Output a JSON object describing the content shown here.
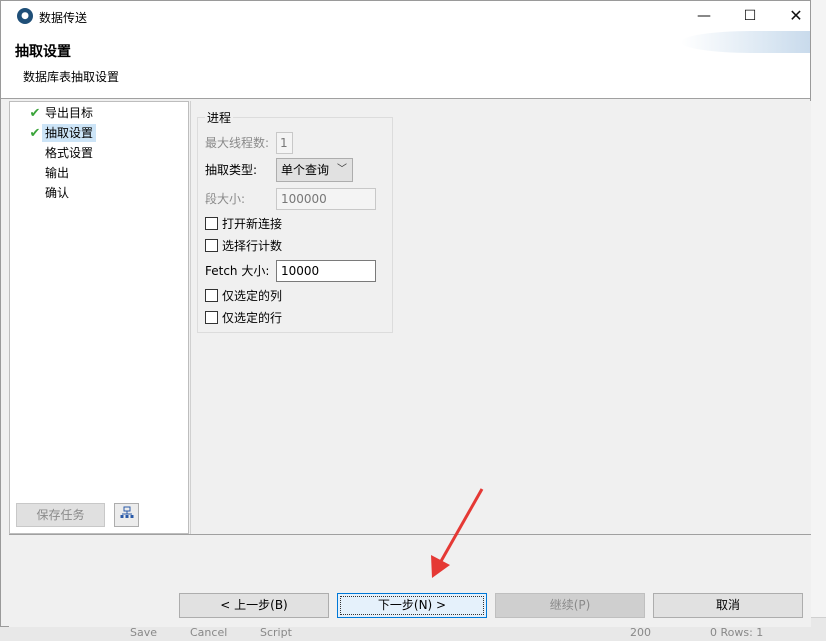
{
  "window": {
    "title": "数据传送",
    "controls": {
      "minimize": "—",
      "maximize": "☐",
      "close": "✕"
    }
  },
  "header": {
    "title": "抽取设置",
    "subtitle": "数据库表抽取设置"
  },
  "steps": [
    {
      "label": "导出目标",
      "checked": true,
      "active": false
    },
    {
      "label": "抽取设置",
      "checked": true,
      "active": true
    },
    {
      "label": "格式设置",
      "checked": false,
      "active": false
    },
    {
      "label": "输出",
      "checked": false,
      "active": false
    },
    {
      "label": "确认",
      "checked": false,
      "active": false
    }
  ],
  "left_panel": {
    "save_task": "保存任务"
  },
  "progress_group": {
    "title": "进程",
    "max_threads_label": "最大线程数:",
    "max_threads_value": "1",
    "extract_type_label": "抽取类型:",
    "extract_type_value": "单个查询",
    "segment_size_label": "段大小:",
    "segment_size_value": "100000",
    "open_new_connection": "打开新连接",
    "select_row_count": "选择行计数",
    "fetch_size_label": "Fetch 大小:",
    "fetch_size_value": "10000",
    "selected_columns_only": "仅选定的列",
    "selected_rows_only": "仅选定的行"
  },
  "buttons": {
    "prev": "< 上一步(B)",
    "next": "下一步(N) >",
    "continue": "继续(P)",
    "cancel": "取消"
  },
  "background_app": {
    "save": "Save",
    "cancel": "Cancel",
    "script": "Script",
    "zoom": "200",
    "rows": "0  Rows: 1"
  },
  "colors": {
    "check": "#3aa43a",
    "selection": "#cce4f7",
    "focus_border": "#0078d7",
    "arrow": "#e53935"
  }
}
